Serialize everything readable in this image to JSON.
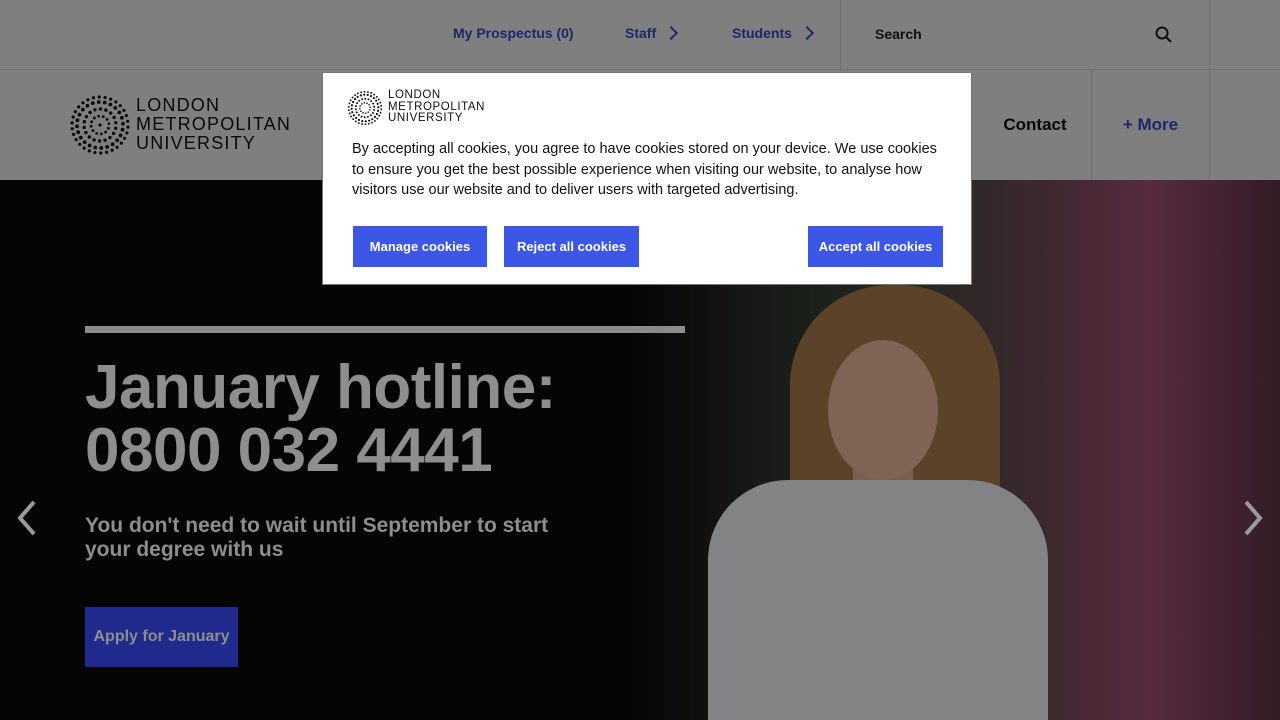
{
  "topbar": {
    "prospectus": "My Prospectus (0)",
    "staff": "Staff",
    "students": "Students",
    "search_placeholder": "Search"
  },
  "nav": {
    "logo_line1": "LONDON",
    "logo_line2": "METROPOLITAN",
    "logo_line3": "UNIVERSITY",
    "contact": "Contact",
    "more": "+ More"
  },
  "hero": {
    "title_line1": "January hotline:",
    "title_line2": "0800 032 4441",
    "subtitle": "You don't need to wait until September to start your degree with us",
    "cta": "Apply for January"
  },
  "cookie_banner": {
    "logo_line1": "LONDON",
    "logo_line2": "METROPOLITAN",
    "logo_line3": "UNIVERSITY",
    "message": "By accepting all cookies, you agree to have cookies stored on your device. We use cookies to ensure you get the best possible experience when visiting our website, to analyse how visitors use our website and to deliver users with targeted advertising.",
    "manage": "Manage cookies",
    "reject": "Reject all cookies",
    "accept": "Accept all cookies"
  },
  "colors": {
    "accent": "#3c57e8",
    "link": "#3c4fd8",
    "cta_bg": "#1f2a8c"
  }
}
